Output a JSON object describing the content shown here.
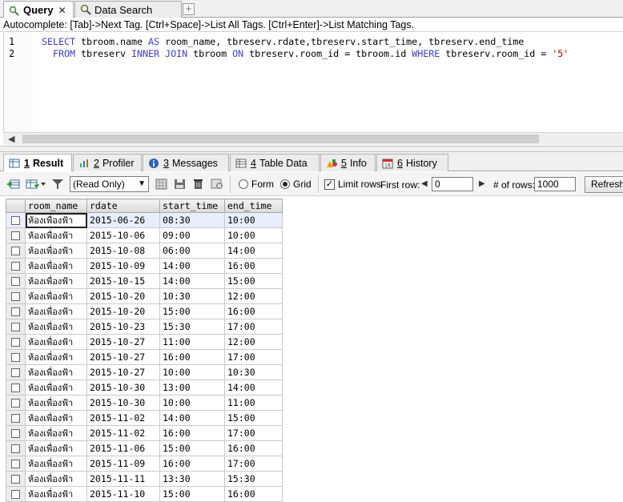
{
  "top_tabs": [
    {
      "label": "Query",
      "icon": "query-icon",
      "close": "✕"
    },
    {
      "label": "Data Search",
      "icon": "search-icon"
    }
  ],
  "new_tab_label": "+",
  "hint": "Autocomplete: [Tab]->Next Tag. [Ctrl+Space]->List All Tags. [Ctrl+Enter]->List Matching Tags.",
  "editor": {
    "line_numbers": [
      "1",
      "2"
    ],
    "line1": {
      "k1": "SELECT",
      "t1": " tbroom.name ",
      "k2": "AS",
      "t2": " room_name, tbreserv.rdate,tbreserv.start_time, tbreserv.end_time"
    },
    "line2": {
      "k1": "FROM",
      "t1": " tbreserv ",
      "k2": "INNER JOIN",
      "t2": " tbroom ",
      "k3": "ON",
      "t3": " tbreserv.room_id = tbroom.id ",
      "k4": "WHERE",
      "t4": " tbreserv.room_id = ",
      "s1": "'5'"
    }
  },
  "result_tabs": [
    {
      "num": "1",
      "label": "Result"
    },
    {
      "num": "2",
      "label": "Profiler"
    },
    {
      "num": "3",
      "label": "Messages"
    },
    {
      "num": "4",
      "label": "Table Data"
    },
    {
      "num": "5",
      "label": "Info"
    },
    {
      "num": "6",
      "label": "History"
    }
  ],
  "toolbar": {
    "mode_select": "(Read Only)",
    "form_label": "Form",
    "grid_label": "Grid",
    "limit_rows_label": "Limit rows",
    "first_row_label": "First row:",
    "first_row_value": "0",
    "num_rows_label": "# of rows:",
    "num_rows_value": "1000",
    "refresh_label": "Refresh"
  },
  "grid": {
    "columns": [
      "room_name",
      "rdate",
      "start_time",
      "end_time"
    ],
    "rows": [
      [
        "ห้องเพื่องฟ้า",
        "2015-06-26",
        "08:30",
        "10:00"
      ],
      [
        "ห้องเพื่องฟ้า",
        "2015-10-06",
        "09:00",
        "10:00"
      ],
      [
        "ห้องเพื่องฟ้า",
        "2015-10-08",
        "06:00",
        "14:00"
      ],
      [
        "ห้องเพื่องฟ้า",
        "2015-10-09",
        "14:00",
        "16:00"
      ],
      [
        "ห้องเพื่องฟ้า",
        "2015-10-15",
        "14:00",
        "15:00"
      ],
      [
        "ห้องเพื่องฟ้า",
        "2015-10-20",
        "10:30",
        "12:00"
      ],
      [
        "ห้องเพื่องฟ้า",
        "2015-10-20",
        "15:00",
        "16:00"
      ],
      [
        "ห้องเพื่องฟ้า",
        "2015-10-23",
        "15:30",
        "17:00"
      ],
      [
        "ห้องเพื่องฟ้า",
        "2015-10-27",
        "11:00",
        "12:00"
      ],
      [
        "ห้องเพื่องฟ้า",
        "2015-10-27",
        "16:00",
        "17:00"
      ],
      [
        "ห้องเพื่องฟ้า",
        "2015-10-27",
        "10:00",
        "10:30"
      ],
      [
        "ห้องเพื่องฟ้า",
        "2015-10-30",
        "13:00",
        "14:00"
      ],
      [
        "ห้องเพื่องฟ้า",
        "2015-10-30",
        "10:00",
        "11:00"
      ],
      [
        "ห้องเพื่องฟ้า",
        "2015-11-02",
        "14:00",
        "15:00"
      ],
      [
        "ห้องเพื่องฟ้า",
        "2015-11-02",
        "16:00",
        "17:00"
      ],
      [
        "ห้องเพื่องฟ้า",
        "2015-11-06",
        "15:00",
        "16:00"
      ],
      [
        "ห้องเพื่องฟ้า",
        "2015-11-09",
        "16:00",
        "17:00"
      ],
      [
        "ห้องเพื่องฟ้า",
        "2015-11-11",
        "13:30",
        "15:30"
      ],
      [
        "ห้องเพื่องฟ้า",
        "2015-11-10",
        "15:00",
        "16:00"
      ]
    ]
  }
}
